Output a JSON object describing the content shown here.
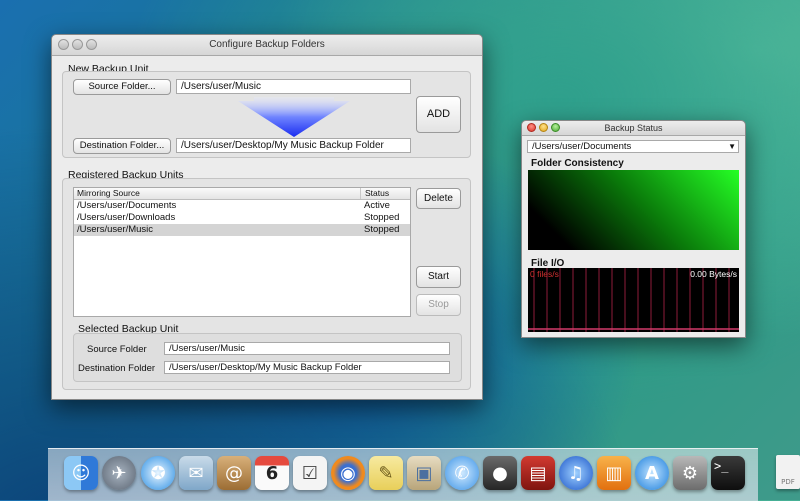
{
  "config_window": {
    "title": "Configure Backup Folders",
    "new_unit": {
      "heading": "New Backup Unit",
      "source_button": "Source Folder...",
      "source_path": "/Users/user/Music",
      "destination_button": "Destination Folder...",
      "destination_path": "/Users/user/Desktop/My Music Backup Folder",
      "add_button": "ADD"
    },
    "registered": {
      "heading": "Registered Backup Units",
      "columns": [
        "Mirroring Source",
        "Status"
      ],
      "rows": [
        {
          "source": "/Users/user/Documents",
          "status": "Active"
        },
        {
          "source": "/Users/user/Downloads",
          "status": "Stopped"
        },
        {
          "source": "/Users/user/Music",
          "status": "Stopped"
        }
      ],
      "delete_button": "Delete",
      "start_button": "Start",
      "stop_button": "Stop"
    },
    "selected": {
      "heading": "Selected Backup Unit",
      "source_label": "Source Folder",
      "source_value": "/Users/user/Music",
      "destination_label": "Destination Folder",
      "destination_value": "/Users/user/Desktop/My Music Backup Folder"
    }
  },
  "status_window": {
    "title": "Backup Status",
    "selected_folder": "/Users/user/Documents",
    "folder_consistency_label": "Folder Consistency",
    "file_io_label": "File I/O",
    "files_rate": "0 files/s",
    "bytes_rate": "0.00 Bytes/s"
  },
  "dock": {
    "items": [
      {
        "name": "finder-icon",
        "glyph": "☺",
        "color": "#3d8be0"
      },
      {
        "name": "launchpad-icon",
        "glyph": "✈",
        "color": "#6a7a8c"
      },
      {
        "name": "safari-icon",
        "glyph": "✪",
        "color": "#2b8fe3"
      },
      {
        "name": "mail-icon",
        "glyph": "✉",
        "color": "#7fa7c9"
      },
      {
        "name": "contacts-icon",
        "glyph": "@",
        "color": "#b98a4e"
      },
      {
        "name": "calendar-icon",
        "glyph": "6",
        "color": "#f4f4f4"
      },
      {
        "name": "reminders-icon",
        "glyph": "☑",
        "color": "#f0f0f0"
      },
      {
        "name": "firefox-icon",
        "glyph": "◉",
        "color": "#e8741b"
      },
      {
        "name": "notes-icon",
        "glyph": "✎",
        "color": "#f3e08a"
      },
      {
        "name": "preview-icon",
        "glyph": "▣",
        "color": "#d9c9a0"
      },
      {
        "name": "messages-icon",
        "glyph": "✆",
        "color": "#5aaef0"
      },
      {
        "name": "facetime-icon",
        "glyph": "●",
        "color": "#3c3c3c"
      },
      {
        "name": "photobooth-icon",
        "glyph": "▤",
        "color": "#b3261e"
      },
      {
        "name": "itunes-icon",
        "glyph": "♫",
        "color": "#2d6fd6"
      },
      {
        "name": "ibooks-icon",
        "glyph": "▥",
        "color": "#f08a1e"
      },
      {
        "name": "appstore-icon",
        "glyph": "A",
        "color": "#2a8fe0"
      },
      {
        "name": "systemprefs-icon",
        "glyph": "⚙",
        "color": "#8c8c8c"
      },
      {
        "name": "terminal-icon",
        "glyph": ">_",
        "color": "#1c1c1c"
      },
      {
        "name": "pdf-document-icon",
        "glyph": "PDF",
        "color": "#eeeeee"
      }
    ]
  }
}
